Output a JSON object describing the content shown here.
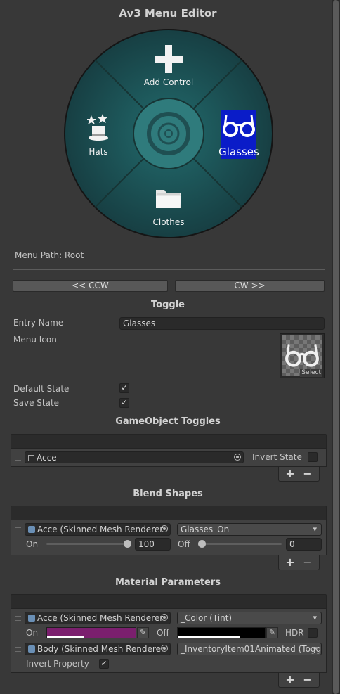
{
  "title": "Av3 Menu Editor",
  "radial": {
    "center_color": "#1d5f60",
    "selected_color": "#0a1cc8",
    "items": [
      {
        "label": "Add Control",
        "icon": "plus-icon"
      },
      {
        "label": "Glasses",
        "icon": "glasses-icon",
        "selected": true
      },
      {
        "label": "Clothes",
        "icon": "folder-icon"
      },
      {
        "label": "Hats",
        "icon": "magic-hat-icon"
      }
    ]
  },
  "menu_path": "Menu Path: Root",
  "nav": {
    "ccw": "<< CCW",
    "cw": "CW >>"
  },
  "toggle": {
    "heading": "Toggle",
    "entry_name_label": "Entry Name",
    "entry_name_value": "Glasses",
    "menu_icon_label": "Menu Icon",
    "icon_select": "Select",
    "default_state_label": "Default State",
    "default_state": "✓",
    "save_state_label": "Save State",
    "save_state": "✓"
  },
  "gameobject_toggles": {
    "heading": "GameObject Toggles",
    "object": "Acce",
    "invert_label": "Invert State",
    "plus": "+",
    "minus": "−"
  },
  "blend_shapes": {
    "heading": "Blend Shapes",
    "renderer": "Acce (Skinned Mesh Renderer",
    "shape": "Glasses_On",
    "on_label": "On",
    "on_value": "100",
    "off_label": "Off",
    "off_value": "0",
    "plus": "+",
    "minus": "−"
  },
  "material_parameters": {
    "heading": "Material Parameters",
    "row1_renderer": "Acce (Skinned Mesh Renderer",
    "row1_property": "_Color (Tint)",
    "on_label": "On",
    "off_label": "Off",
    "hdr_label": "HDR",
    "on_color": "#7b1f6e",
    "off_color": "#000000",
    "row2_renderer": "Body (Skinned Mesh Renderer",
    "row2_property": "_InventoryItem01Animated (Togg",
    "invert_property_label": "Invert Property",
    "invert_property": "✓",
    "plus": "+",
    "minus": "−"
  }
}
